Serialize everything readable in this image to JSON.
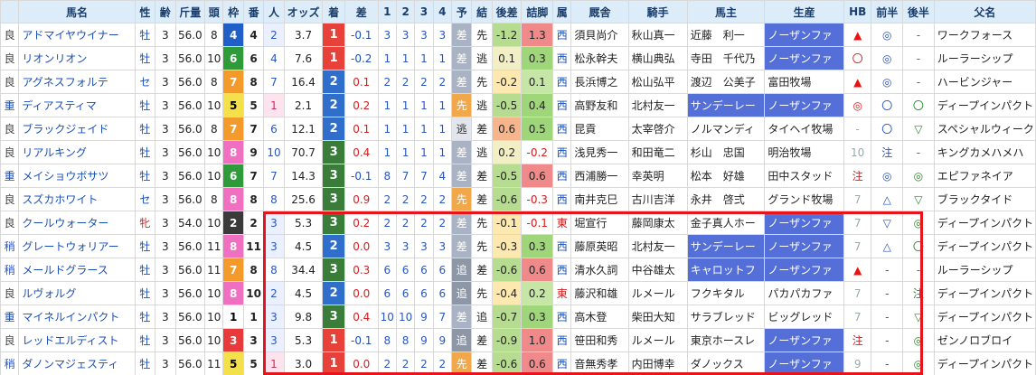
{
  "headers": [
    "",
    "馬名",
    "性",
    "齢",
    "斤量",
    "頭",
    "枠",
    "番",
    "人",
    "オッズ",
    "着",
    "差",
    "1",
    "2",
    "3",
    "4",
    "予",
    "結",
    "後差",
    "詰脚",
    "属",
    "厩舎",
    "騎手",
    "馬主",
    "生産",
    "HB",
    "前半",
    "後半",
    "父名"
  ],
  "rows": [
    {
      "baba": "良",
      "horse": "アドマイヤウイナー",
      "sex": "牡",
      "age": "3",
      "kin": "56.0",
      "to": "8",
      "waku": "4",
      "ban": "4",
      "pop": "2",
      "odds": "3.7",
      "fin": "1",
      "mar": "-0.1",
      "c1": "3",
      "c2": "3",
      "c3": "3",
      "c4": "3",
      "yo": "差",
      "res": "先",
      "ato": "-1.2",
      "tsu": "1.3",
      "zoku": "西",
      "trainer": "須貝尚介",
      "jockey": "秋山真一",
      "owner": "近藤　利一",
      "breeder": "ノーザンファ",
      "hb": "▲",
      "zen": "◎",
      "kou": "-",
      "sire": "ワークフォース"
    },
    {
      "baba": "良",
      "horse": "リオンリオン",
      "sex": "牡",
      "age": "3",
      "kin": "56.0",
      "to": "10",
      "waku": "6",
      "ban": "6",
      "pop": "4",
      "odds": "7.6",
      "fin": "1",
      "mar": "-0.2",
      "c1": "1",
      "c2": "1",
      "c3": "1",
      "c4": "1",
      "yo": "差",
      "res": "逃",
      "ato": "0.1",
      "tsu": "0.3",
      "zoku": "西",
      "trainer": "松永幹夫",
      "jockey": "横山典弘",
      "owner": "寺田　千代乃",
      "breeder": "ノーザンファ",
      "hb": "〇",
      "zen": "◎",
      "kou": "-",
      "sire": "ルーラーシップ"
    },
    {
      "baba": "良",
      "horse": "アグネスフォルテ",
      "sex": "セ",
      "age": "3",
      "kin": "56.0",
      "to": "8",
      "waku": "7",
      "ban": "8",
      "pop": "7",
      "odds": "16.4",
      "fin": "2",
      "mar": "0.1",
      "c1": "2",
      "c2": "2",
      "c3": "2",
      "c4": "2",
      "yo": "差",
      "res": "先",
      "ato": "-0.2",
      "tsu": "0.1",
      "zoku": "西",
      "trainer": "長浜博之",
      "jockey": "松山弘平",
      "owner": "渡辺　公美子",
      "breeder": "富田牧場",
      "hb": "▲",
      "zen": "◎",
      "kou": "-",
      "sire": "ハービンジャー"
    },
    {
      "baba": "重",
      "horse": "ディアスティマ",
      "sex": "牡",
      "age": "3",
      "kin": "56.0",
      "to": "10",
      "waku": "5",
      "ban": "5",
      "pop": "1",
      "odds": "2.1",
      "fin": "2",
      "mar": "0.2",
      "c1": "1",
      "c2": "1",
      "c3": "1",
      "c4": "1",
      "yo": "先",
      "res": "逃",
      "ato": "-0.5",
      "tsu": "0.4",
      "zoku": "西",
      "trainer": "高野友和",
      "jockey": "北村友一",
      "owner": "サンデーレー",
      "breeder": "ノーザンファ",
      "hb": "◎",
      "zen": "〇",
      "kou": "〇",
      "sire": "ディープインパクト"
    },
    {
      "baba": "良",
      "horse": "ブラックジェイド",
      "sex": "牡",
      "age": "3",
      "kin": "56.0",
      "to": "8",
      "waku": "7",
      "ban": "7",
      "pop": "6",
      "odds": "12.1",
      "fin": "2",
      "mar": "0.1",
      "c1": "1",
      "c2": "1",
      "c3": "1",
      "c4": "1",
      "yo": "逃",
      "res": "差",
      "ato": "0.6",
      "tsu": "0.5",
      "zoku": "西",
      "trainer": "昆貢",
      "jockey": "太宰啓介",
      "owner": "ノルマンディ",
      "breeder": "タイヘイ牧場",
      "hb": "-",
      "zen": "〇",
      "kou": "▽",
      "sire": "スペシャルウィーク"
    },
    {
      "baba": "良",
      "horse": "リアルキング",
      "sex": "牡",
      "age": "3",
      "kin": "56.0",
      "to": "10",
      "waku": "8",
      "ban": "9",
      "pop": "10",
      "odds": "70.7",
      "fin": "3",
      "mar": "0.4",
      "c1": "1",
      "c2": "1",
      "c3": "1",
      "c4": "1",
      "yo": "差",
      "res": "逃",
      "ato": "0.2",
      "tsu": "-0.2",
      "zoku": "西",
      "trainer": "浅見秀一",
      "jockey": "和田竜二",
      "owner": "杉山　忠国",
      "breeder": "明治牧場",
      "hb": "10",
      "zen": "注",
      "kou": "-",
      "sire": "キングカメハメハ"
    },
    {
      "baba": "重",
      "horse": "メイショウボサツ",
      "sex": "牡",
      "age": "3",
      "kin": "56.0",
      "to": "10",
      "waku": "6",
      "ban": "7",
      "pop": "7",
      "odds": "14.3",
      "fin": "3",
      "mar": "-0.1",
      "c1": "8",
      "c2": "7",
      "c3": "7",
      "c4": "4",
      "yo": "差",
      "res": "差",
      "ato": "-0.5",
      "tsu": "0.6",
      "zoku": "西",
      "trainer": "西浦勝一",
      "jockey": "幸英明",
      "owner": "松本　好雄",
      "breeder": "田中スタッド",
      "hb": "注",
      "zen": "◎",
      "kou": "◎",
      "sire": "エピファネイア"
    },
    {
      "baba": "良",
      "horse": "スズカホワイト",
      "sex": "セ",
      "age": "3",
      "kin": "56.0",
      "to": "8",
      "waku": "8",
      "ban": "8",
      "pop": "8",
      "odds": "25.6",
      "fin": "3",
      "mar": "0.9",
      "c1": "2",
      "c2": "2",
      "c3": "2",
      "c4": "2",
      "yo": "先",
      "res": "差",
      "ato": "-0.6",
      "tsu": "-0.3",
      "zoku": "西",
      "trainer": "南井克巳",
      "jockey": "古川吉洋",
      "owner": "永井　啓弍",
      "breeder": "グランド牧場",
      "hb": "7",
      "zen": "△",
      "kou": "▽",
      "sire": "ブラックタイド"
    },
    {
      "baba": "良",
      "horse": "クールウォーター",
      "sex": "牝",
      "age": "3",
      "kin": "54.0",
      "to": "10",
      "waku": "2",
      "ban": "2",
      "pop": "3",
      "odds": "5.3",
      "fin": "3",
      "mar": "0.2",
      "c1": "2",
      "c2": "2",
      "c3": "2",
      "c4": "2",
      "yo": "差",
      "res": "先",
      "ato": "-0.1",
      "tsu": "-0.1",
      "zoku": "東",
      "trainer": "堀宣行",
      "jockey": "藤岡康太",
      "owner": "金子真人ホー",
      "breeder": "ノーザンファ",
      "hb": "7",
      "zen": "▽",
      "kou": "◎",
      "sire": "ディープインパクト"
    },
    {
      "baba": "稍",
      "horse": "グレートウォリアー",
      "sex": "牡",
      "age": "3",
      "kin": "56.0",
      "to": "11",
      "waku": "8",
      "ban": "11",
      "pop": "3",
      "odds": "4.5",
      "fin": "2",
      "mar": "0.0",
      "c1": "3",
      "c2": "3",
      "c3": "3",
      "c4": "3",
      "yo": "差",
      "res": "先",
      "ato": "-0.3",
      "tsu": "0.3",
      "zoku": "西",
      "trainer": "藤原英昭",
      "jockey": "北村友一",
      "owner": "サンデーレー",
      "breeder": "ノーザンファ",
      "hb": "7",
      "zen": "△",
      "kou": "〇",
      "sire": "ディープインパクト"
    },
    {
      "baba": "稍",
      "horse": "メールドグラース",
      "sex": "牡",
      "age": "3",
      "kin": "56.0",
      "to": "11",
      "waku": "7",
      "ban": "8",
      "pop": "8",
      "odds": "34.4",
      "fin": "3",
      "mar": "0.3",
      "c1": "6",
      "c2": "6",
      "c3": "6",
      "c4": "6",
      "yo": "追",
      "res": "差",
      "ato": "-0.6",
      "tsu": "0.6",
      "zoku": "西",
      "trainer": "清水久詞",
      "jockey": "中谷雄太",
      "owner": "キャロットフ",
      "breeder": "ノーザンファ",
      "hb": "▲",
      "zen": "-",
      "kou": "-",
      "sire": "ルーラーシップ"
    },
    {
      "baba": "良",
      "horse": "ルヴォルグ",
      "sex": "牡",
      "age": "3",
      "kin": "56.0",
      "to": "10",
      "waku": "8",
      "ban": "10",
      "pop": "2",
      "odds": "4.5",
      "fin": "2",
      "mar": "0.0",
      "c1": "6",
      "c2": "6",
      "c3": "6",
      "c4": "6",
      "yo": "追",
      "res": "先",
      "ato": "-0.4",
      "tsu": "0.2",
      "zoku": "東",
      "trainer": "藤沢和雄",
      "jockey": "ルメール",
      "owner": "フクキタル",
      "breeder": "パカパカファ",
      "hb": "7",
      "zen": "-",
      "kou": "注",
      "sire": "ディープインパクト"
    },
    {
      "baba": "重",
      "horse": "マイネルインパクト",
      "sex": "牡",
      "age": "3",
      "kin": "56.0",
      "to": "10",
      "waku": "1",
      "ban": "1",
      "pop": "3",
      "odds": "9.8",
      "fin": "3",
      "mar": "0.4",
      "c1": "10",
      "c2": "10",
      "c3": "9",
      "c4": "7",
      "yo": "差",
      "res": "追",
      "ato": "-0.7",
      "tsu": "0.3",
      "zoku": "西",
      "trainer": "高木登",
      "jockey": "柴田大知",
      "owner": "サラブレッド",
      "breeder": "ビッグレッド",
      "hb": "7",
      "zen": "-",
      "kou": "▽",
      "sire": "ディープインパクト"
    },
    {
      "baba": "良",
      "horse": "レッドエルディスト",
      "sex": "牡",
      "age": "3",
      "kin": "56.0",
      "to": "10",
      "waku": "3",
      "ban": "3",
      "pop": "3",
      "odds": "5.3",
      "fin": "1",
      "mar": "-0.1",
      "c1": "8",
      "c2": "8",
      "c3": "9",
      "c4": "9",
      "yo": "追",
      "res": "差",
      "ato": "-0.9",
      "tsu": "1.0",
      "zoku": "西",
      "trainer": "笹田和秀",
      "jockey": "ルメール",
      "owner": "東京ホースレ",
      "breeder": "ノーザンファ",
      "hb": "注",
      "zen": "-",
      "kou": "◎",
      "sire": "ゼンノロブロイ"
    },
    {
      "baba": "稍",
      "horse": "ダノンマジェスティ",
      "sex": "牡",
      "age": "3",
      "kin": "56.0",
      "to": "11",
      "waku": "5",
      "ban": "5",
      "pop": "1",
      "odds": "3.0",
      "fin": "1",
      "mar": "0.0",
      "c1": "2",
      "c2": "2",
      "c3": "2",
      "c4": "2",
      "yo": "先",
      "res": "差",
      "ato": "-0.6",
      "tsu": "0.6",
      "zoku": "西",
      "trainer": "音無秀孝",
      "jockey": "内田博幸",
      "owner": "ダノックス",
      "breeder": "ノーザンファ",
      "hb": "9",
      "zen": "-",
      "kou": "◎",
      "sire": "ディープインパクト"
    }
  ]
}
